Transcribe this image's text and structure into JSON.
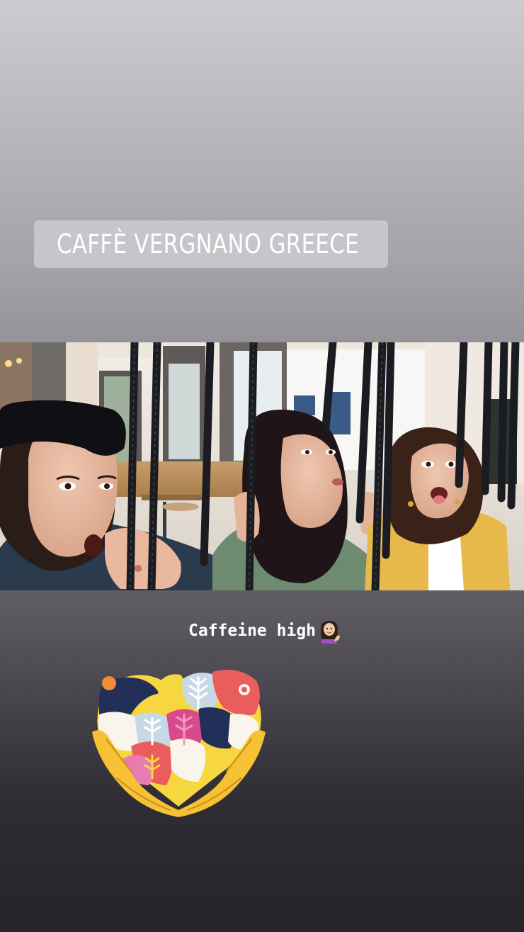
{
  "story": {
    "location_sticker": {
      "text": "CAFFÈ VERGNANO GREECE",
      "icon": "location-pin-icon"
    },
    "photo": {
      "alt": ""
    },
    "caption": {
      "text": "Caffeine high",
      "emoji_icon": "woman-tipping-hand-emoji"
    },
    "sticker": {
      "icon": "hands-holding-heart-sticker"
    }
  }
}
